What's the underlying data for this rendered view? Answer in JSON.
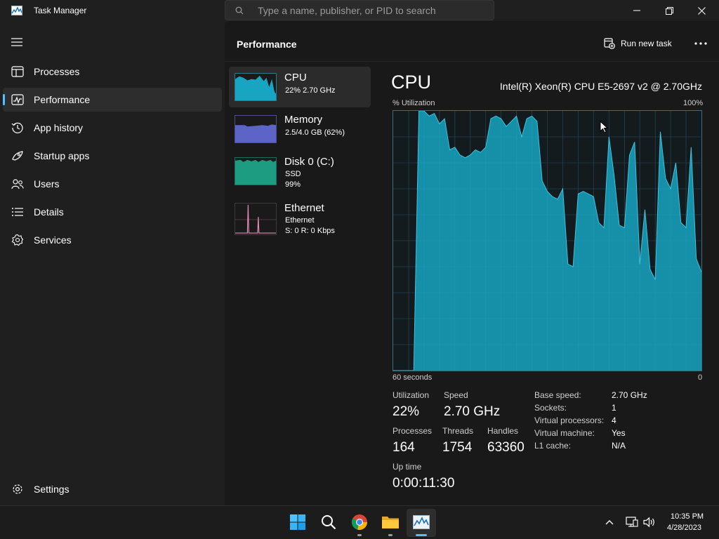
{
  "window": {
    "title": "Task Manager",
    "search_placeholder": "Type a name, publisher, or PID to search"
  },
  "colors": {
    "accent": "#4cc2ff",
    "cpu": "#17a5c2",
    "memory": "#5d64c8",
    "disk": "#1d9c82",
    "ethernet": "#e28ab6"
  },
  "nav": {
    "items": [
      {
        "label": "Processes",
        "icon": "processes-icon"
      },
      {
        "label": "Performance",
        "icon": "performance-icon"
      },
      {
        "label": "App history",
        "icon": "app-history-icon"
      },
      {
        "label": "Startup apps",
        "icon": "startup-apps-icon"
      },
      {
        "label": "Users",
        "icon": "users-icon"
      },
      {
        "label": "Details",
        "icon": "details-icon"
      },
      {
        "label": "Services",
        "icon": "services-icon"
      }
    ],
    "settings": "Settings"
  },
  "header": {
    "title": "Performance",
    "run_new_task": "Run new task"
  },
  "devices": [
    {
      "name": "CPU",
      "line1": "22%  2.70 GHz",
      "line2": ""
    },
    {
      "name": "Memory",
      "line1": "2.5/4.0 GB (62%)",
      "line2": ""
    },
    {
      "name": "Disk 0 (C:)",
      "line1": "SSD",
      "line2": "99%"
    },
    {
      "name": "Ethernet",
      "line1": "Ethernet",
      "line2": "S: 0  R: 0 Kbps"
    }
  ],
  "detail": {
    "title": "CPU",
    "model": "Intel(R) Xeon(R) CPU E5-2697 v2 @ 2.70GHz",
    "util_label": "% Utilization",
    "max_label": "100%",
    "time_span": "60 seconds",
    "time_end": "0",
    "stats": {
      "utilization_label": "Utilization",
      "utilization": "22%",
      "speed_label": "Speed",
      "speed": "2.70 GHz",
      "processes_label": "Processes",
      "processes": "164",
      "threads_label": "Threads",
      "threads": "1754",
      "handles_label": "Handles",
      "handles": "63360",
      "uptime_label": "Up time",
      "uptime": "0:00:11:30"
    },
    "info": [
      {
        "k": "Base speed:",
        "v": "2.70 GHz"
      },
      {
        "k": "Sockets:",
        "v": "1"
      },
      {
        "k": "Virtual processors:",
        "v": "4"
      },
      {
        "k": "Virtual machine:",
        "v": "Yes"
      },
      {
        "k": "L1 cache:",
        "v": "N/A"
      }
    ]
  },
  "chart_data": {
    "type": "area",
    "ylim": [
      0,
      100
    ],
    "x": [
      60,
      59,
      58,
      57,
      56,
      55,
      54,
      53,
      52,
      51,
      50,
      49,
      48,
      47,
      46,
      45,
      44,
      43,
      42,
      41,
      40,
      39,
      38,
      37,
      36,
      35,
      34,
      33,
      32,
      31,
      30,
      29,
      28,
      27,
      26,
      25,
      24,
      23,
      22,
      21,
      20,
      19,
      18,
      17,
      16,
      15,
      14,
      13,
      12,
      11,
      10,
      9,
      8,
      7,
      6,
      5,
      4,
      3,
      2,
      1,
      0
    ],
    "values": [
      0,
      0,
      0,
      0,
      0,
      100,
      100,
      98,
      99,
      95,
      97,
      85,
      86,
      83,
      82,
      83,
      85,
      84,
      86,
      97,
      98,
      97,
      94,
      96,
      98,
      90,
      97,
      98,
      96,
      73,
      69,
      67,
      66,
      70,
      41,
      40,
      68,
      69,
      68,
      67,
      57,
      55,
      90,
      75,
      56,
      55,
      83,
      88,
      41,
      62,
      39,
      35,
      92,
      74,
      70,
      80,
      57,
      55,
      86,
      43,
      38
    ]
  },
  "taskbar": {
    "icons": [
      "windows-start-icon",
      "search-icon",
      "chrome-icon",
      "file-explorer-icon",
      "task-manager-icon"
    ],
    "time": "10:35 PM",
    "date": "4/28/2023"
  }
}
